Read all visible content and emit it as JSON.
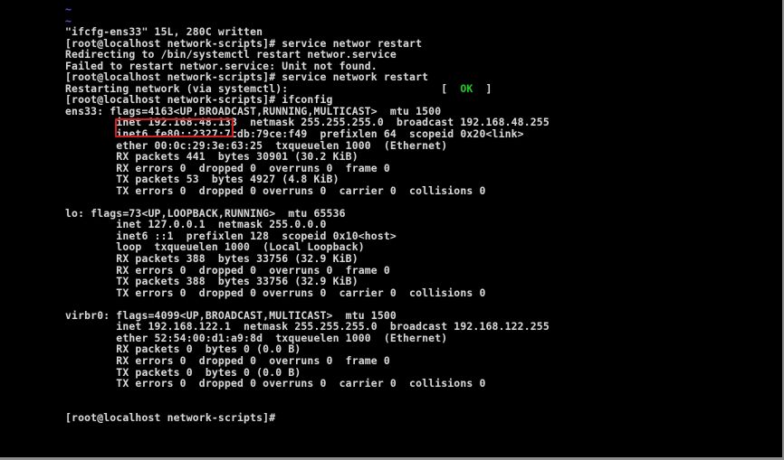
{
  "terminal": {
    "hostname": "localhost",
    "user": "root",
    "cwd": "network-scripts",
    "prompt": "[root@localhost network-scripts]#",
    "colors": {
      "background": "#000000",
      "foreground": "#d6d6d6",
      "tilde": "#4a4ad4",
      "ok_green": "#1ec81e",
      "highlight_red": "#d21f1f",
      "bezel_gray": "#8d8d8d"
    },
    "lines": [
      {
        "id": "tilde-1",
        "class": "tilde",
        "text": "~"
      },
      {
        "id": "tilde-2",
        "class": "tilde",
        "text": "~"
      },
      {
        "id": "vim-write",
        "class": "",
        "text": "\"ifcfg-ens33\" 15L, 280C written"
      },
      {
        "id": "cmd-service-networ-restart",
        "class": "",
        "text": "[root@localhost network-scripts]# service networ restart"
      },
      {
        "id": "redirect-systemctl",
        "class": "",
        "text": "Redirecting to /bin/systemctl restart networ.service"
      },
      {
        "id": "failed-unit-not-found",
        "class": "",
        "text": "Failed to restart networ.service: Unit not found."
      },
      {
        "id": "cmd-service-network-restart",
        "class": "",
        "text": "[root@localhost network-scripts]# service network restart"
      },
      {
        "id": "restarting-network",
        "class": "",
        "text": "Restarting network (via systemctl):                        [  OK  ]",
        "ok_segment": "OK"
      },
      {
        "id": "cmd-ifconfig",
        "class": "",
        "text": "[root@localhost network-scripts]# ifconfig"
      },
      {
        "id": "ens33-flags",
        "class": "",
        "text": "ens33: flags=4163<UP,BROADCAST,RUNNING,MULTICAST>  mtu 1500"
      },
      {
        "id": "ens33-inet",
        "class": "",
        "text": "        inet 192.168.48.133  netmask 255.255.255.0  broadcast 192.168.48.255"
      },
      {
        "id": "ens33-inet6",
        "class": "",
        "text": "        inet6 fe80::2327:7cdb:79ce:f49  prefixlen 64  scopeid 0x20<link>"
      },
      {
        "id": "ens33-ether",
        "class": "",
        "text": "        ether 00:0c:29:3e:63:25  txqueuelen 1000  (Ethernet)"
      },
      {
        "id": "ens33-rx-packets",
        "class": "",
        "text": "        RX packets 441  bytes 30901 (30.2 KiB)"
      },
      {
        "id": "ens33-rx-errors",
        "class": "",
        "text": "        RX errors 0  dropped 0  overruns 0  frame 0"
      },
      {
        "id": "ens33-tx-packets",
        "class": "",
        "text": "        TX packets 53  bytes 4927 (4.8 KiB)"
      },
      {
        "id": "ens33-tx-errors",
        "class": "",
        "text": "        TX errors 0  dropped 0 overruns 0  carrier 0  collisions 0"
      },
      {
        "id": "blank-1",
        "class": "",
        "text": " "
      },
      {
        "id": "lo-flags",
        "class": "",
        "text": "lo: flags=73<UP,LOOPBACK,RUNNING>  mtu 65536"
      },
      {
        "id": "lo-inet",
        "class": "",
        "text": "        inet 127.0.0.1  netmask 255.0.0.0"
      },
      {
        "id": "lo-inet6",
        "class": "",
        "text": "        inet6 ::1  prefixlen 128  scopeid 0x10<host>"
      },
      {
        "id": "lo-loop",
        "class": "",
        "text": "        loop  txqueuelen 1000  (Local Loopback)"
      },
      {
        "id": "lo-rx-packets",
        "class": "",
        "text": "        RX packets 388  bytes 33756 (32.9 KiB)"
      },
      {
        "id": "lo-rx-errors",
        "class": "",
        "text": "        RX errors 0  dropped 0  overruns 0  frame 0"
      },
      {
        "id": "lo-tx-packets",
        "class": "",
        "text": "        TX packets 388  bytes 33756 (32.9 KiB)"
      },
      {
        "id": "lo-tx-errors",
        "class": "",
        "text": "        TX errors 0  dropped 0 overruns 0  carrier 0  collisions 0"
      },
      {
        "id": "blank-2",
        "class": "",
        "text": " "
      },
      {
        "id": "virbr0-flags",
        "class": "",
        "text": "virbr0: flags=4099<UP,BROADCAST,MULTICAST>  mtu 1500"
      },
      {
        "id": "virbr0-inet",
        "class": "",
        "text": "        inet 192.168.122.1  netmask 255.255.255.0  broadcast 192.168.122.255"
      },
      {
        "id": "virbr0-ether",
        "class": "",
        "text": "        ether 52:54:00:d1:a9:8d  txqueuelen 1000  (Ethernet)"
      },
      {
        "id": "virbr0-rx-packets",
        "class": "",
        "text": "        RX packets 0  bytes 0 (0.0 B)"
      },
      {
        "id": "virbr0-rx-errors",
        "class": "",
        "text": "        RX errors 0  dropped 0  overruns 0  frame 0"
      },
      {
        "id": "virbr0-tx-packets",
        "class": "",
        "text": "        TX packets 0  bytes 0 (0.0 B)"
      },
      {
        "id": "virbr0-tx-errors",
        "class": "",
        "text": "        TX errors 0  dropped 0 overruns 0  carrier 0  collisions 0"
      },
      {
        "id": "blank-3",
        "class": "",
        "text": " "
      },
      {
        "id": "blank-4",
        "class": "",
        "text": " "
      },
      {
        "id": "final-prompt",
        "class": "",
        "text": "[root@localhost network-scripts]#"
      }
    ],
    "annotation": {
      "label": "inet-address-highlight",
      "highlighted_text": "inet 192.168.48.133",
      "color": "#d21f1f"
    }
  }
}
